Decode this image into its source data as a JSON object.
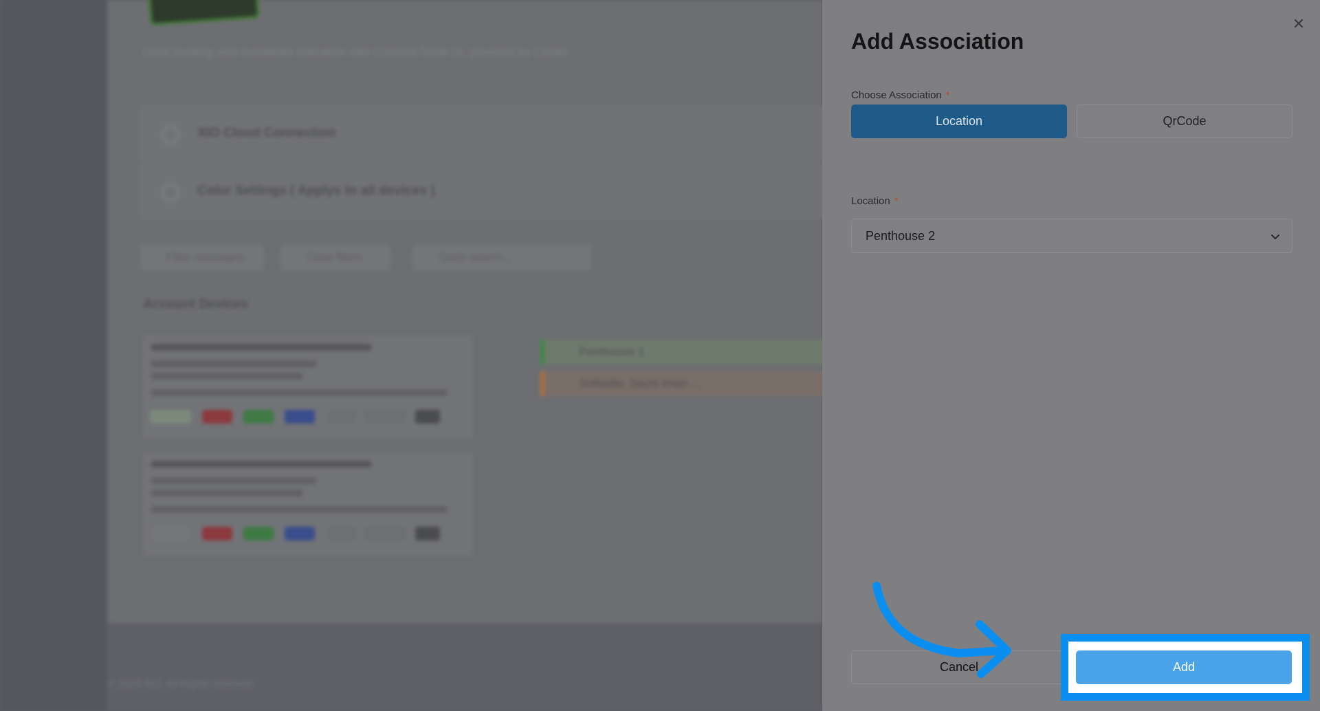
{
  "background": {
    "description_text": "Desk booking and availability indication with Crestron Desk UI, powered by Cardio",
    "panels": [
      "XIO Cloud Connection",
      "Color Settings ( Applys to all devices )"
    ],
    "filters": [
      "Filter messages",
      "Clear filters",
      "Quick search..."
    ],
    "section_title": "Account Devices",
    "devices": [
      {
        "title": "Device Id: https://prefix.centro.network",
        "status": "Online",
        "color_labels": [
          "Brnt",
          "Disable"
        ]
      },
      {
        "title": "Device Id: https://prefix.centro.network",
        "status": "Offline",
        "color_labels": [
          "Brnt",
          "Disable"
        ]
      }
    ],
    "associations": [
      "Penthouse 1",
      "Sofitaille: Sachi khan ..."
    ],
    "footer": "© 2023 XiO. All Rights reserved"
  },
  "drawer": {
    "title": "Add Association",
    "close_icon": "close-icon",
    "choose_label": "Choose Association",
    "options": [
      "Location",
      "QrCode"
    ],
    "selected_option": "Location",
    "location_label": "Location",
    "required_mark": "*",
    "location_value": "Penthouse 2",
    "cancel_label": "Cancel",
    "add_label": "Add"
  },
  "colors": {
    "primary": "#1e5a87",
    "add_button": "#4aa3e8",
    "highlight": "#0a8ff0"
  }
}
